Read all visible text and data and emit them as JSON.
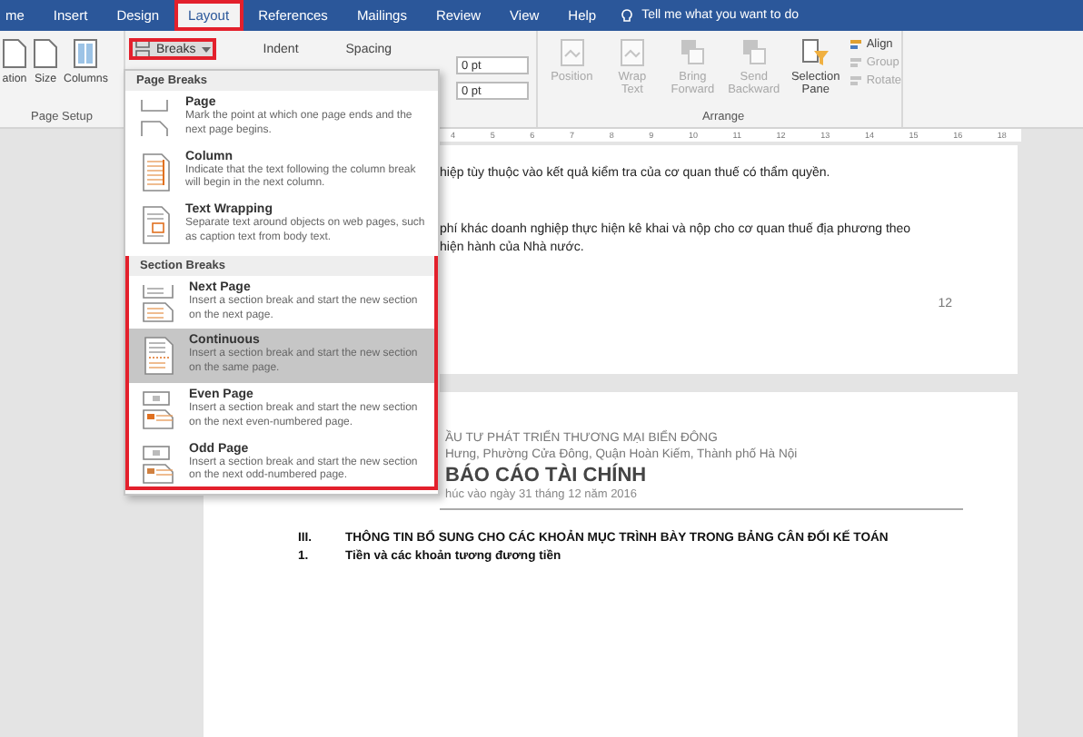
{
  "tabs": [
    {
      "label": "me",
      "selected": false,
      "highlighted": false
    },
    {
      "label": "Insert",
      "selected": false,
      "highlighted": false
    },
    {
      "label": "Design",
      "selected": false,
      "highlighted": false
    },
    {
      "label": "Layout",
      "selected": true,
      "highlighted": true
    },
    {
      "label": "References",
      "selected": false,
      "highlighted": false
    },
    {
      "label": "Mailings",
      "selected": false,
      "highlighted": false
    },
    {
      "label": "Review",
      "selected": false,
      "highlighted": false
    },
    {
      "label": "View",
      "selected": false,
      "highlighted": false
    },
    {
      "label": "Help",
      "selected": false,
      "highlighted": false
    }
  ],
  "tell_me": "Tell me what you want to do",
  "ribbon": {
    "page_setup": {
      "buttons": [
        {
          "label": "ation",
          "kind": "page"
        },
        {
          "label": "Size",
          "kind": "page"
        },
        {
          "label": "Columns",
          "kind": "columns"
        }
      ],
      "group_label": "Page Setup"
    },
    "breaks": {
      "label": "Breaks",
      "highlighted": true
    },
    "indent_label": "Indent",
    "spacing_label": "Spacing",
    "spacing_fields": [
      {
        "value": "0 pt"
      },
      {
        "value": "0 pt"
      }
    ],
    "arrange": {
      "buttons": [
        {
          "label": "Position",
          "kind": "picture",
          "disabled": true
        },
        {
          "label": "Wrap Text",
          "kind": "picture",
          "disabled": true
        },
        {
          "label": "Bring Forward",
          "kind": "layers",
          "disabled": true
        },
        {
          "label": "Send Backward",
          "kind": "layers",
          "disabled": true
        },
        {
          "label": "Selection Pane",
          "kind": "pane",
          "disabled": false
        }
      ],
      "small_buttons": [
        {
          "label": "Align",
          "disabled": false
        },
        {
          "label": "Group",
          "disabled": true
        },
        {
          "label": "Rotate",
          "disabled": true
        }
      ],
      "group_label": "Arrange"
    }
  },
  "breaks_menu": {
    "sections": [
      {
        "header": "Page Breaks",
        "highlighted": false,
        "items": [
          {
            "kind": "page",
            "title": "Page",
            "description": "Mark the point at which one page ends and the next page begins.",
            "selected": false
          },
          {
            "kind": "column",
            "title": "Column",
            "description": "Indicate that the text following the column break will begin in the next column.",
            "selected": false
          },
          {
            "kind": "text-wrapping",
            "title": "Text Wrapping",
            "description": "Separate text around objects on web pages, such as caption text from body text.",
            "selected": false
          }
        ]
      },
      {
        "header": "Section Breaks",
        "highlighted": true,
        "items": [
          {
            "kind": "next-page",
            "title": "Next Page",
            "description": "Insert a section break and start the new section on the next page.",
            "selected": false
          },
          {
            "kind": "continuous",
            "title": "Continuous",
            "description": "Insert a section break and start the new section on the same page.",
            "selected": true
          },
          {
            "kind": "even-page",
            "title": "Even Page",
            "description": "Insert a section break and start the new section on the next even-numbered page.",
            "selected": false
          },
          {
            "kind": "odd-page",
            "title": "Odd Page",
            "description": "Insert a section break and start the new section on the next odd-numbered page.",
            "selected": false
          }
        ]
      }
    ]
  },
  "ruler": {
    "ticks": [
      "4",
      "5",
      "6",
      "7",
      "8",
      "9",
      "10",
      "11",
      "12",
      "13",
      "14",
      "15",
      "16",
      "18"
    ]
  },
  "document": {
    "pages": [
      {
        "blocks": [
          {
            "kind": "body",
            "lines": [
              "hiệp tùy thuộc vào kết quả kiểm tra của cơ quan thuế có thẩm quyền."
            ]
          },
          {
            "kind": "body",
            "lines": [
              "phí khác doanh nghiệp thực hiện kê khai và nộp cho cơ quan thuế địa phương theo",
              "hiện hành của Nhà nước."
            ]
          },
          {
            "kind": "page-number",
            "text": "12"
          }
        ]
      },
      {
        "blocks": [
          {
            "kind": "company",
            "lines": [
              "ẦU TƯ PHÁT TRIỂN THƯƠNG MẠI BIỂN ĐÔNG",
              "Hưng, Phường Cửa Đông, Quận Hoàn Kiếm, Thành phố Hà Nội"
            ]
          },
          {
            "kind": "title",
            "text": "BÁO CÁO TÀI CHÍNH"
          },
          {
            "kind": "subtitle",
            "text": "húc vào ngày 31 tháng 12 năm 2016"
          },
          {
            "kind": "rule"
          },
          {
            "kind": "numbered",
            "items": [
              {
                "marker": "III.",
                "text": "THÔNG TIN BỔ SUNG CHO CÁC KHOẢN MỤC TRÌNH BÀY TRONG BẢNG CÂN ĐỐI KẾ TOÁN"
              },
              {
                "marker": "1.",
                "text": "Tiền và các khoản tương đương tiền"
              }
            ]
          }
        ]
      }
    ]
  }
}
